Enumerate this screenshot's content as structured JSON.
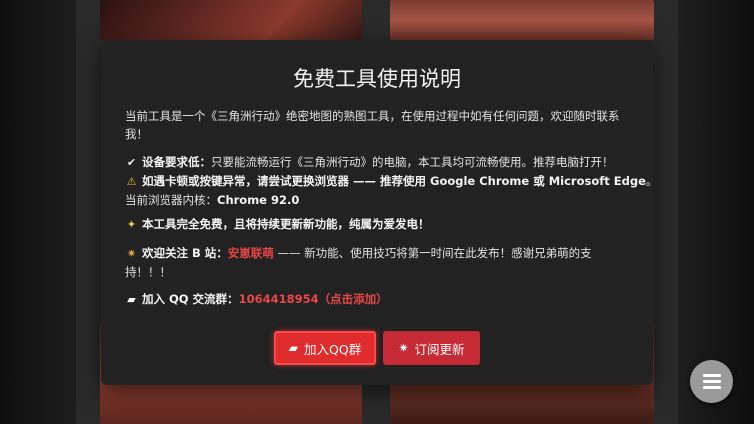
{
  "modal": {
    "title": "免费工具使用说明",
    "intro": "当前工具是一个《三角洲行动》绝密地图的熟图工具，在使用过程中如有任何问题，欢迎随时联系我！",
    "requirements": {
      "label": "设备要求低：",
      "text": "只要能流畅运行《三角洲行动》的电脑，本工具均可流畅使用。推荐电脑打开！",
      "warn_text": "如遇卡顿或按键异常，请尝试更换浏览器 —— ",
      "recommend": "推荐使用 Google Chrome 或 Microsoft Edge",
      "recommend_end": "。",
      "kernel_label": "当前浏览器内核：",
      "kernel_value": "Chrome 92.0"
    },
    "free": {
      "label": "本工具完全免费，",
      "text": "且将持续更新新功能，纯属为爱发电！"
    },
    "follow": {
      "prefix": "欢迎关注 ",
      "site": "B 站",
      "colon": "：",
      "account": "安崽联萌",
      "text": " —— 新功能、使用技巧将第一时间在此发布！感谢兄弟萌的支持！！！"
    },
    "qq_group": {
      "label": "加入 QQ 交流群：",
      "number": "1064418954（点击添加）"
    },
    "buttons": {
      "join_qq": "加入QQ群",
      "subscribe": "订阅更新"
    }
  },
  "colors": {
    "accent_red": "#e84747",
    "button_red": "#e02c2c",
    "modal_bg": "#222222"
  },
  "icons": [
    "check-icon",
    "warning-icon",
    "sparkle-icon",
    "party-icon",
    "chat-icon",
    "menu-icon"
  ]
}
